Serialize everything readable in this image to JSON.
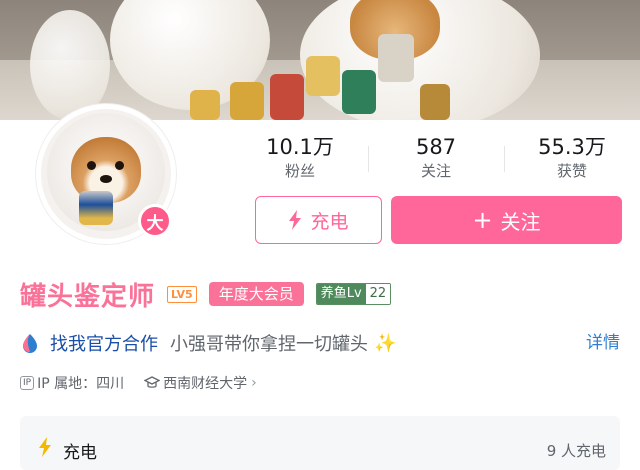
{
  "banner": {
    "image": "shiba-dogs-with-cans-photo"
  },
  "avatar": {
    "image": "shiba-avatar",
    "badge_label": "大"
  },
  "stats": [
    {
      "value": "10.1万",
      "label": "粉丝"
    },
    {
      "value": "587",
      "label": "关注"
    },
    {
      "value": "55.3万",
      "label": "获赞"
    }
  ],
  "actions": {
    "charge_label": "充电",
    "follow_label": "关注",
    "follow_icon": "+"
  },
  "profile": {
    "name": "罐头鉴定师",
    "level": "LV5",
    "vip_label": "年度大会员",
    "fan_badge_name": "养鱼Lv",
    "fan_badge_level": "22"
  },
  "cooperation": {
    "link_label": "找我官方合作",
    "signature": "小强哥带你拿捏一切罐头",
    "sparkle": "✨",
    "detail_label": "详情"
  },
  "meta": {
    "ip_badge": "IP",
    "ip_location": "IP 属地：四川",
    "school": "西南财经大学",
    "school_chevron": "›"
  },
  "charge_panel": {
    "title": "充电",
    "count": "9 人充电"
  },
  "colors": {
    "accent": "#ff6699",
    "name": "#fb7299",
    "link": "#1a4ea8",
    "detail": "#2f7fd0"
  }
}
